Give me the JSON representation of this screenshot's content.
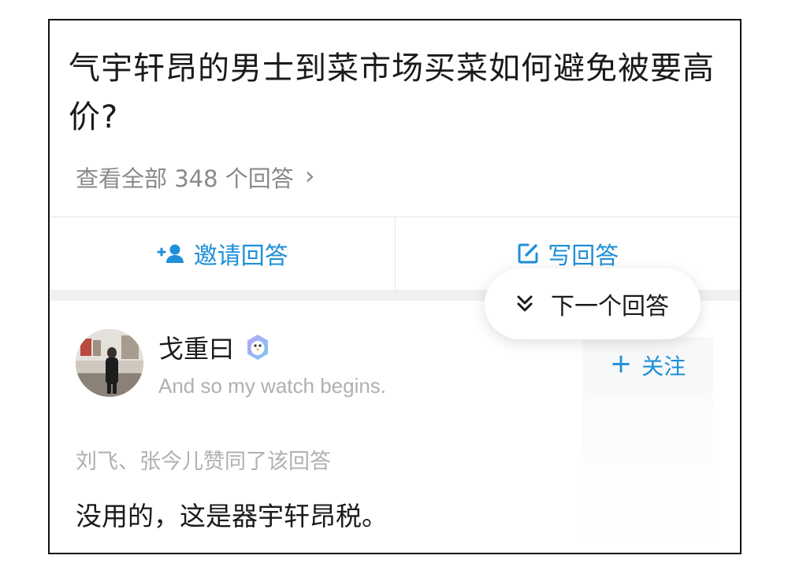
{
  "question": {
    "title": "气宇轩昂的男士到菜市场买菜如何避免被要高价?",
    "view_all": "查看全部 348 个回答"
  },
  "actions": {
    "invite": "邀请回答",
    "write": "写回答"
  },
  "next_popup": {
    "label": "下一个回答"
  },
  "answer": {
    "author": {
      "name": "戈重曰",
      "bio": "And so my watch begins.",
      "badge_icon": "penguin-badge-icon",
      "avatar_icon": "avatar-photo"
    },
    "follow_label": "关注",
    "upvoters": "刘飞、张今儿赞同了该回答",
    "text": "没用的，这是器宇轩昂税。"
  },
  "colors": {
    "accent": "#1e8fd8",
    "title_text": "#1a1a1a",
    "secondary_text": "#8a8a8a",
    "muted_text": "#b0b0b0"
  }
}
